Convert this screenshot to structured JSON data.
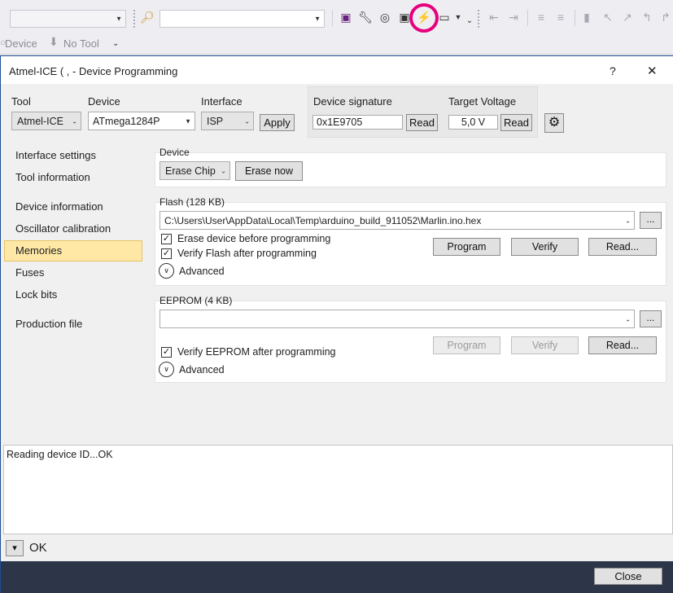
{
  "toolbar": {
    "status_device": "Device",
    "status_tool": "No Tool",
    "overflow": "⌄"
  },
  "dialog": {
    "title": "Atmel-ICE (                     , - Device Programming",
    "help": "?",
    "close_x": "✕"
  },
  "config": {
    "tool_label": "Tool",
    "tool_value": "Atmel-ICE",
    "device_label": "Device",
    "device_value": "ATmega1284P",
    "interface_label": "Interface",
    "interface_value": "ISP",
    "apply": "Apply",
    "signature_label": "Device signature",
    "signature_value": "0x1E9705",
    "signature_read": "Read",
    "voltage_label": "Target Voltage",
    "voltage_value": "5,0 V",
    "voltage_read": "Read"
  },
  "sidebar": {
    "items": [
      {
        "label": "Interface settings"
      },
      {
        "label": "Tool information"
      },
      {
        "label": "Device information"
      },
      {
        "label": "Oscillator calibration"
      },
      {
        "label": "Memories"
      },
      {
        "label": "Fuses"
      },
      {
        "label": "Lock bits"
      },
      {
        "label": "Production file"
      }
    ]
  },
  "device_group": {
    "title": "Device",
    "erase_select": "Erase Chip",
    "erase_now": "Erase now"
  },
  "flash_group": {
    "title": "Flash (128 KB)",
    "file_path": "C:\\Users\\User\\AppData\\Local\\Temp\\arduino_build_911052\\Marlin.ino.hex",
    "browse": "...",
    "erase_before": "Erase device before programming",
    "verify_after": "Verify Flash after programming",
    "program": "Program",
    "verify": "Verify",
    "read": "Read...",
    "advanced": "Advanced"
  },
  "eeprom_group": {
    "title": "EEPROM (4 KB)",
    "file_path": "",
    "browse": "...",
    "verify_after": "Verify EEPROM after programming",
    "program": "Program",
    "verify": "Verify",
    "read": "Read...",
    "advanced": "Advanced"
  },
  "log": {
    "text": "Reading device ID...OK"
  },
  "statusbar": {
    "expand": "▾",
    "text": "OK"
  },
  "footer": {
    "close": "Close"
  },
  "colors": {
    "selected_nav": "#ffe8a6",
    "footer_bg": "#2d3648",
    "highlight_ring": "#e6007e"
  }
}
